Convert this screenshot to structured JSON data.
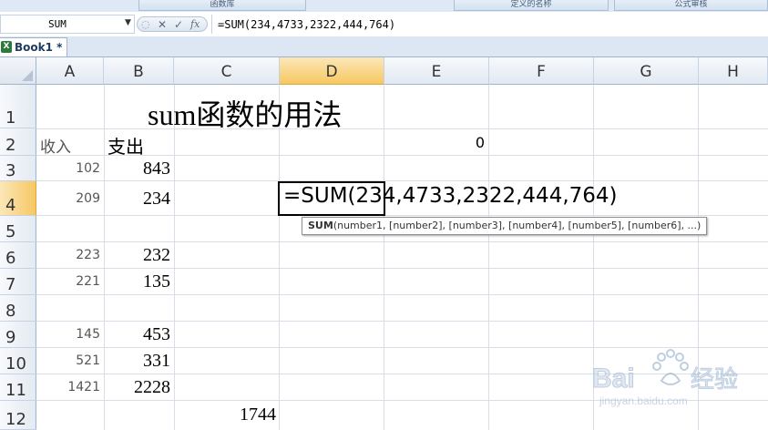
{
  "ribbon": {
    "groups": [
      "函数库",
      "定义的名称",
      "公式审核"
    ]
  },
  "formula_bar": {
    "name_box": "SUM",
    "cancel_glyph": "✕",
    "enter_glyph": "✓",
    "fx_glyph": "fx",
    "formula": "=SUM(234,4733,2322,444,764)"
  },
  "workbook": {
    "tab_label": "Book1 *"
  },
  "sheet": {
    "columns": [
      "A",
      "B",
      "C",
      "D",
      "E",
      "F",
      "G",
      "H"
    ],
    "selected_column": "D",
    "rows": [
      "1",
      "2",
      "3",
      "4",
      "5",
      "6",
      "7",
      "8",
      "9",
      "10",
      "11",
      "12"
    ],
    "selected_row": "4",
    "title": "sum函数的用法",
    "header_income": "收入",
    "header_expense": "支出",
    "e2_value": "0",
    "income": [
      "102",
      "209",
      "223",
      "221",
      "145",
      "521",
      "1421"
    ],
    "expense": [
      "843",
      "234",
      "232",
      "135",
      "453",
      "331",
      "2228"
    ],
    "c12_value": "1744",
    "editing_text": "=SUM(234,4733,2322,444,764)",
    "tooltip_fn": "SUM",
    "tooltip_args": "(number1, [number2], [number3], [number4], [number5], [number6], ...)"
  },
  "watermark": {
    "brand": "Bai",
    "brand_cn": "经验",
    "url": "jingyan.baidu.com"
  },
  "colors": {
    "selection_header": "#f6c862",
    "grid_line": "#d8dfe8",
    "header_bg": "#e2e9f2",
    "excel_icon": "#2c7a3b"
  }
}
